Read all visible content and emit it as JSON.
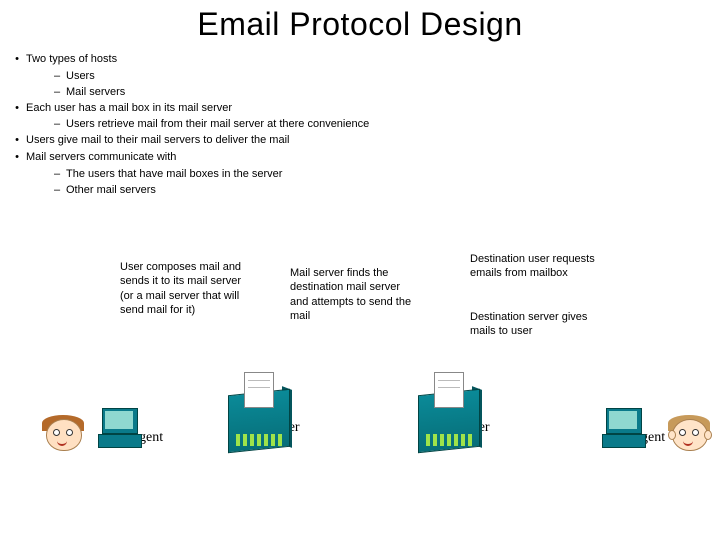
{
  "title": "Email Protocol Design",
  "bullets": [
    {
      "level": 1,
      "text": "Two types of hosts"
    },
    {
      "level": 2,
      "text": "Users"
    },
    {
      "level": 2,
      "text": "Mail servers"
    },
    {
      "level": 1,
      "text": "Each user has a mail box in its mail server"
    },
    {
      "level": 2,
      "text": "Users retrieve mail from their mail server at there convenience"
    },
    {
      "level": 1,
      "text": "Users give mail to their mail servers to deliver the mail"
    },
    {
      "level": 1,
      "text": "Mail servers communicate with"
    },
    {
      "level": 2,
      "text": "The users that have mail boxes in the server"
    },
    {
      "level": 2,
      "text": "Other mail servers"
    }
  ],
  "desc": {
    "d1": "User composes mail and sends it to its mail server (or a mail server that will send mail for it)",
    "d2": "Mail server finds the destination mail server and attempts to send the mail",
    "d3": "Destination user requests emails from mailbox",
    "d4": "Destination server gives mails to user"
  },
  "labels": {
    "ua1": "user agent",
    "ms1": "mail server",
    "ms2": "mail server",
    "ua2": "user agent"
  }
}
